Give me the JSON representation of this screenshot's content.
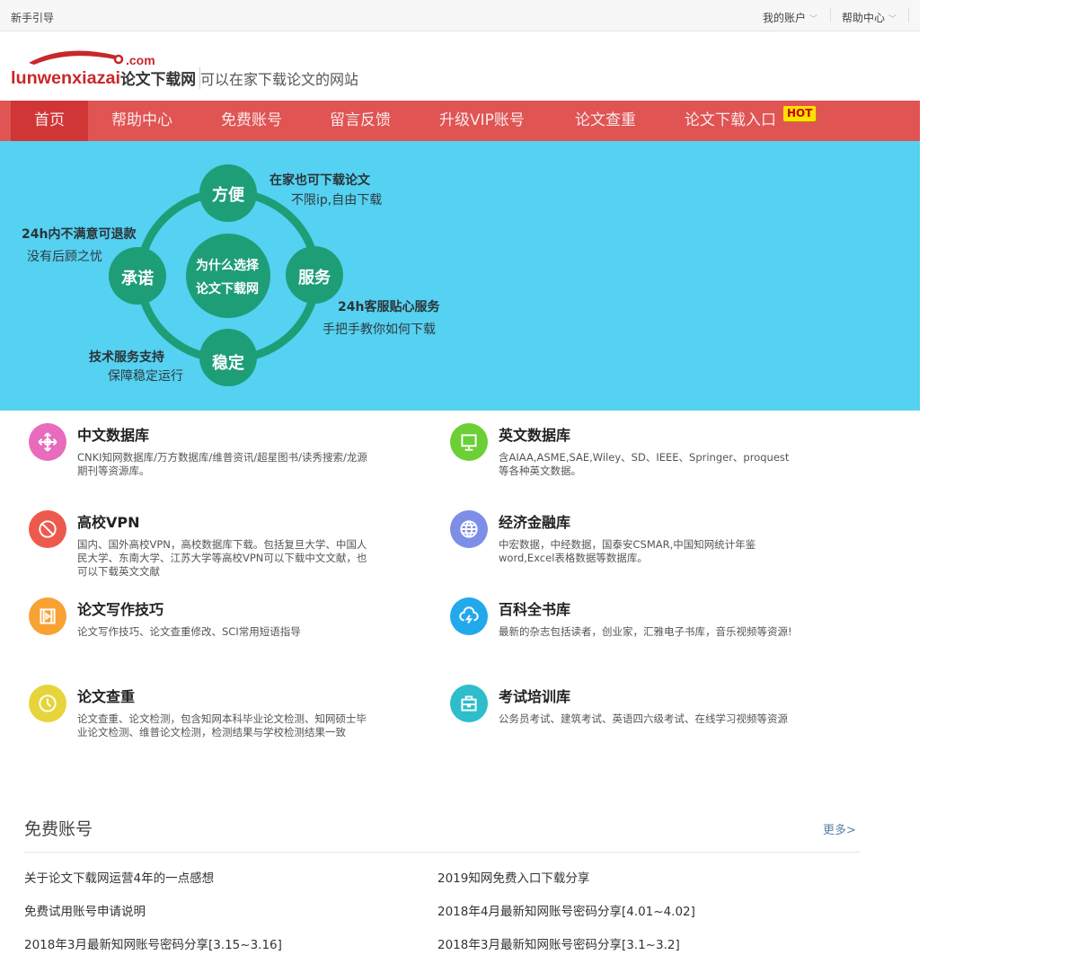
{
  "topbar": {
    "guide": "新手引导",
    "account": "我的账户",
    "help": "帮助中心"
  },
  "header": {
    "logo_text": "lunwenxiazai论文下载网 .com",
    "slogan": "可以在家下载论文的网站"
  },
  "nav": {
    "items": [
      "首页",
      "帮助中心",
      "免费账号",
      "留言反馈",
      "升级VIP账号",
      "论文查重",
      "论文下载入口"
    ],
    "hot_badge": "HOT"
  },
  "banner": {
    "center": [
      "为什么选择",
      "论文下载网"
    ],
    "nodes": {
      "top": "方便",
      "left": "承诺",
      "right": "服务",
      "bottom": "稳定"
    },
    "notes": {
      "top_title": "在家也可下载论文",
      "top_sub": "不限ip,自由下载",
      "left_title": "24h内不满意可退款",
      "left_sub": "没有后顾之忧",
      "right_title": "24h客服贴心服务",
      "right_sub": "手把手教你如何下载",
      "bottom_title": "技术服务支持",
      "bottom_sub": "保障稳定运行"
    }
  },
  "features": [
    {
      "title": "中文数据库",
      "desc": "CNKI知网数据库/万方数据库/维普资讯/超星图书/读秀搜索/龙源期刊等资源库。",
      "icon": "move-arrows-icon",
      "color": "#e86bbd"
    },
    {
      "title": "英文数据库",
      "desc": "含AIAA,ASME,SAE,Wiley、SD、IEEE、Springer、proquest等各种英文数据。",
      "icon": "monitor-icon",
      "color": "#6ccf36"
    },
    {
      "title": "高校VPN",
      "desc": "国内、国外高校VPN，高校数据库下载。包括复旦大学、中国人民大学、东南大学、江苏大学等高校VPN可以下载中文文献，也可以下载英文文献",
      "icon": "ban-icon",
      "color": "#ec5a4d"
    },
    {
      "title": "经济金融库",
      "desc": "中宏数据，中经数据，国泰安CSMAR,中国知网统计年鉴word,Excel表格数据等数据库。",
      "icon": "globe-icon",
      "color": "#7e8ee6"
    },
    {
      "title": "论文写作技巧",
      "desc": "论文写作技巧、论文查重修改、SCI常用短语指导",
      "icon": "film-icon",
      "color": "#f7a233"
    },
    {
      "title": "百科全书库",
      "desc": "最新的杂志包括读者，创业家，汇雅电子书库，音乐视频等资源!",
      "icon": "cloud-lightning-icon",
      "color": "#22a9ec"
    },
    {
      "title": "论文查重",
      "desc": "论文查重、论文检测，包含知网本科毕业论文检测、知网硕士毕业论文检测、维普论文检测，检测结果与学校检测结果一致",
      "icon": "clock-icon",
      "color": "#e6d43a"
    },
    {
      "title": "考试培训库",
      "desc": "公务员考试、建筑考试、英语四六级考试、在线学习视频等资源",
      "icon": "briefcase-icon",
      "color": "#2dbdcb"
    }
  ],
  "free_accounts": {
    "title": "免费账号",
    "more": "更多>",
    "items": [
      "关于论文下载网运营4年的一点感想",
      "2019知网免费入口下载分享",
      "免费试用账号申请说明",
      "2018年4月最新知网账号密码分享[4.01~4.02]",
      "2018年3月最新知网账号密码分享[3.15~3.16]",
      "2018年3月最新知网账号密码分享[3.1~3.2]"
    ]
  }
}
